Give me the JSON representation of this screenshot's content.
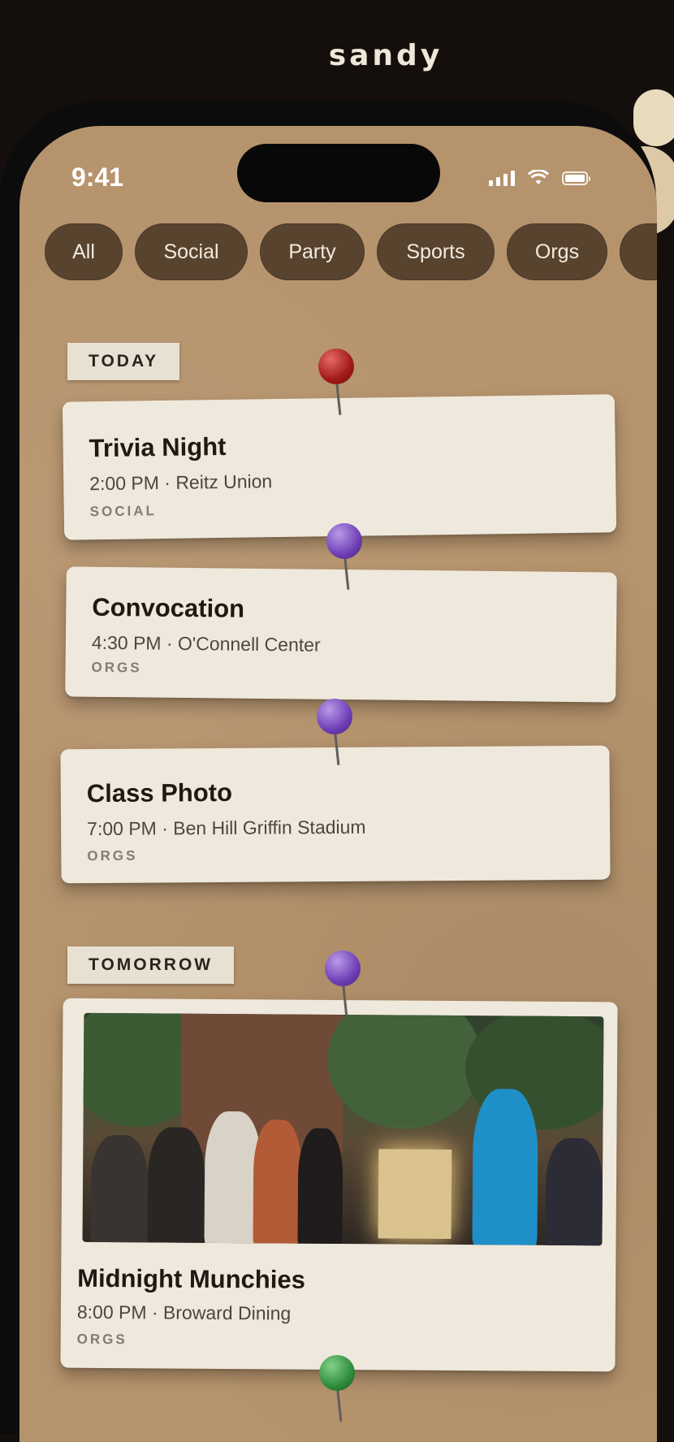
{
  "brand": "sandy",
  "status_bar": {
    "time": "9:41"
  },
  "filters": [
    {
      "label": "All"
    },
    {
      "label": "Social"
    },
    {
      "label": "Party"
    },
    {
      "label": "Sports"
    },
    {
      "label": "Orgs"
    }
  ],
  "sections": {
    "today": {
      "label": "TODAY",
      "events": [
        {
          "title": "Trivia Night",
          "meta": "2:00 PM · Reitz Union",
          "category": "SOCIAL"
        },
        {
          "title": "Convocation",
          "meta": "4:30 PM · O'Connell Center",
          "category": "ORGS"
        },
        {
          "title": "Class Photo",
          "meta": "7:00 PM · Ben Hill Griffin Stadium",
          "category": "ORGS"
        }
      ]
    },
    "tomorrow": {
      "label": "TOMORROW",
      "events": [
        {
          "title": "Midnight Munchies",
          "meta": "8:00 PM · Broward Dining",
          "category": "ORGS"
        }
      ]
    }
  },
  "pin_colors": {
    "red": "#a11919",
    "purple": "#6f3fb6",
    "green": "#2f8d3b"
  }
}
